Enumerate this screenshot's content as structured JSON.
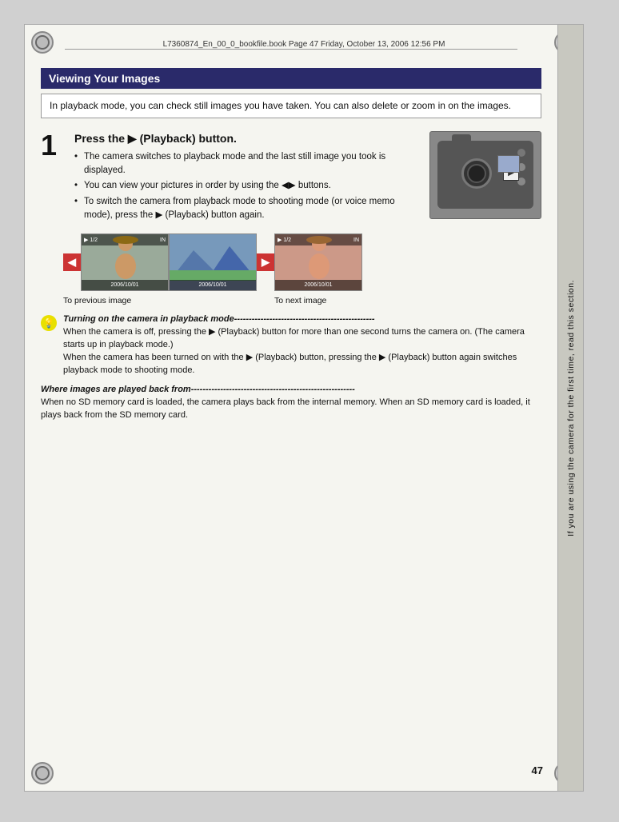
{
  "header": {
    "file_info": "L7360874_En_00_0_bookfile.book  Page 47  Friday, October 13, 2006  12:56 PM"
  },
  "sidebar": {
    "text": "If you are using the camera for the first time, read this section."
  },
  "title": "Viewing Your Images",
  "intro": "In playback mode, you can check still images you have taken. You can also delete or zoom in on the images.",
  "step1": {
    "number": "1",
    "title": "Press the ▶ (Playback) button.",
    "bullets": [
      "The camera switches to playback mode and the last still image you took is displayed.",
      "You can view your pictures in order by using the ◀▶ buttons.",
      "To switch the camera from playback mode to shooting mode (or voice memo mode), press the ▶ (Playback) button again."
    ]
  },
  "image_labels": {
    "prev": "To previous image",
    "next": "To next image"
  },
  "tip1": {
    "title": "Turning on the camera in playback mode",
    "dashes": "------------------------------------------------",
    "lines": [
      "When the camera is off, pressing the ▶ (Playback) button for more than one second turns the camera on. (The camera starts up in playback mode.)",
      "When the camera has been turned on with the ▶ (Playback) button, pressing the ▶ (Playback) button again switches playback mode to shooting mode."
    ]
  },
  "tip2": {
    "title": "Where images are played back from",
    "dashes": "--------------------------------------------------------",
    "lines": [
      "When no SD memory card is loaded, the camera plays back from the internal memory. When an SD memory card is loaded, it plays back from the SD memory card."
    ]
  },
  "page_number": "47",
  "thumb_dates": {
    "left": "2006/10/01",
    "center": "2006/10/01",
    "right": "2006/10/01"
  }
}
